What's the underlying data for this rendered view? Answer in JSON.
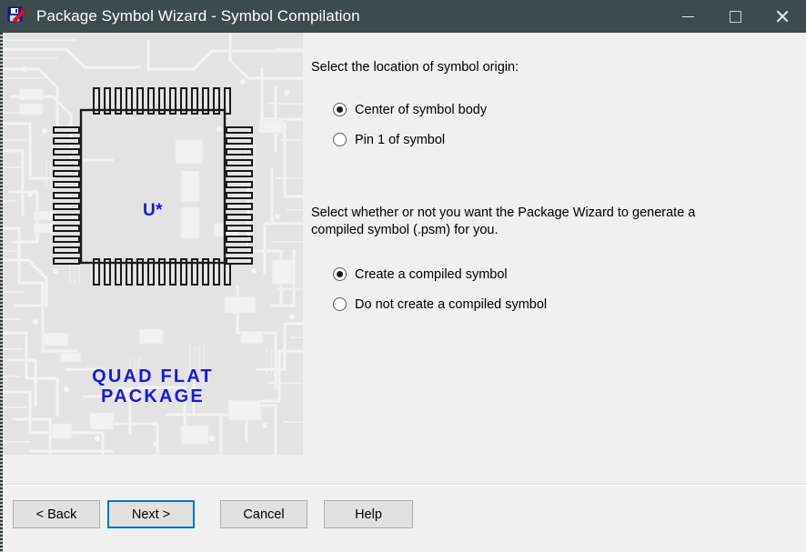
{
  "window": {
    "title": "Package Symbol Wizard - Symbol Compilation",
    "icon": "floppy-disk-wizard-icon",
    "titlebar_color": "#3d4b4e",
    "body_color": "#f0f0f0",
    "controls": {
      "minimize": "minimize-icon",
      "maximize": "maximize-icon",
      "close": "close-icon"
    }
  },
  "illustration": {
    "panel_background": "#e2e2e2",
    "chip_label": "U*",
    "chip_label_color": "#1a16e8",
    "caption_line1": "QUAD FLAT",
    "caption_line2": "PACKAGE",
    "caption_color": "#1a16e8",
    "pins_per_side": 13
  },
  "content": {
    "prompt_origin": "Select the location of symbol origin:",
    "origin_options": [
      {
        "label": "Center of symbol body",
        "selected": true
      },
      {
        "label": "Pin 1 of symbol",
        "selected": false
      }
    ],
    "prompt_compile": "Select whether or not you want the Package Wizard to generate a compiled symbol (.psm) for you.",
    "compile_options": [
      {
        "label": "Create a compiled symbol",
        "selected": true
      },
      {
        "label": "Do not create a compiled symbol",
        "selected": false
      }
    ]
  },
  "footer": {
    "back_label": "< Back",
    "next_label": "Next >",
    "cancel_label": "Cancel",
    "help_label": "Help",
    "focus_color": "#0078d7"
  }
}
